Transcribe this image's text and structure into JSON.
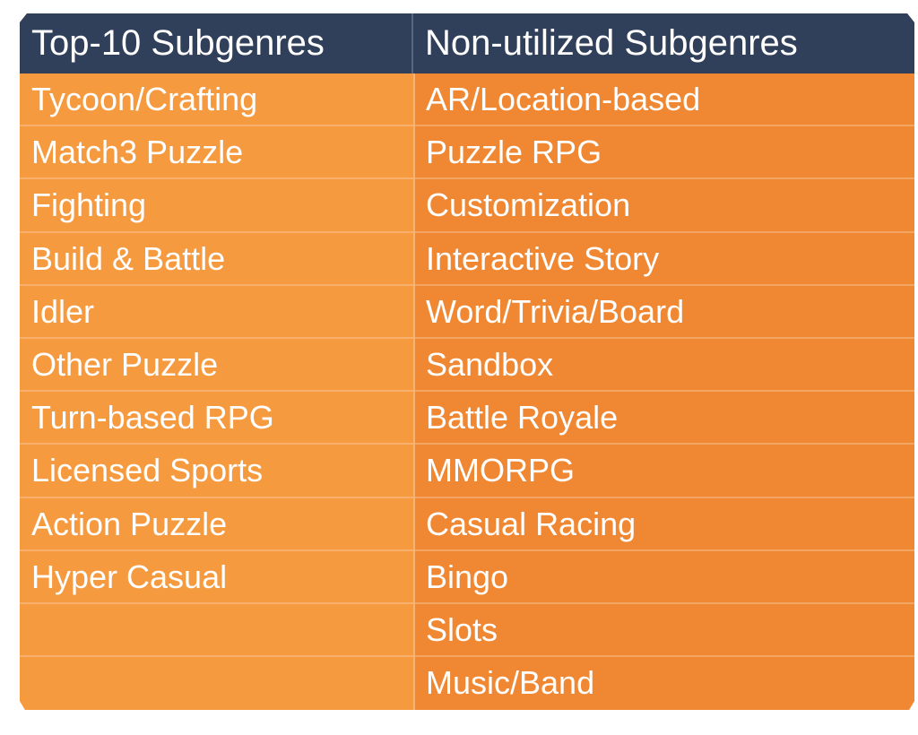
{
  "table": {
    "headers": [
      "Top-10 Subgenres",
      "Non-utilized Subgenres"
    ],
    "top10": [
      "Tycoon/Crafting",
      "Match3 Puzzle",
      "Fighting",
      "Build & Battle",
      "Idler",
      "Other Puzzle",
      "Turn-based RPG",
      "Licensed Sports",
      "Action Puzzle",
      "Hyper Casual",
      "",
      ""
    ],
    "non_utilized": [
      "AR/Location-based",
      "Puzzle RPG",
      "Customization",
      "Interactive Story",
      "Word/Trivia/Board",
      "Sandbox",
      "Battle Royale",
      "MMORPG",
      "Casual Racing",
      "Bingo",
      "Slots",
      "Music/Band"
    ]
  },
  "colors": {
    "header_bg": "#303f5a",
    "col1_bg": "#f69a40",
    "col2_bg": "#f08833",
    "text": "#ffffff"
  }
}
